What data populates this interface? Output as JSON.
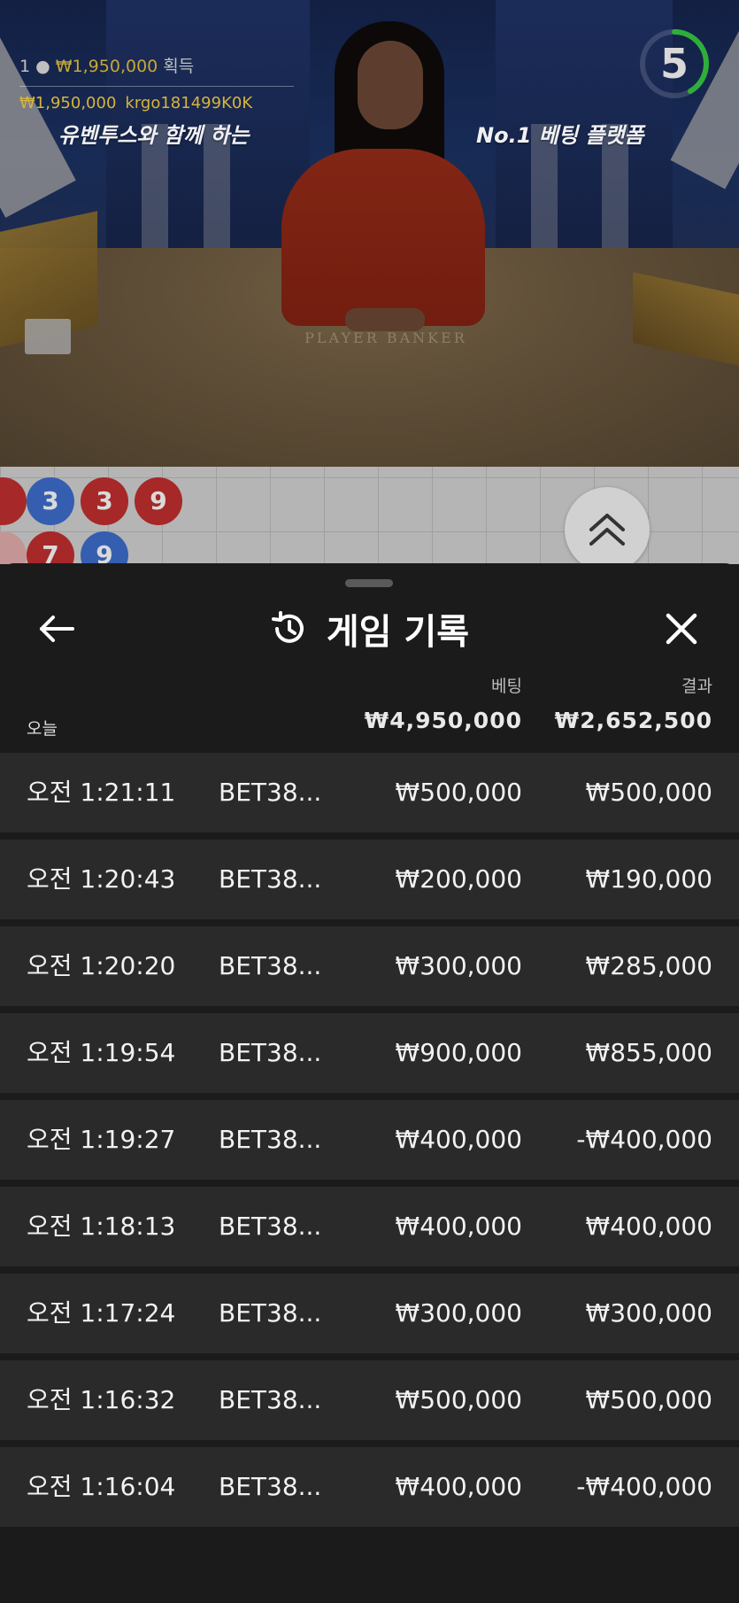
{
  "overlay": {
    "winner_count": "1",
    "winner_amount": "₩1,950,000",
    "winner_suffix": "획득",
    "balance": "₩1,950,000",
    "username": "krgo181499K0K",
    "banner_left": "유벤투스와 함께 하는",
    "banner_right": "No.1 베팅 플랫폼",
    "table_text": "PLAYER   BANKER",
    "countdown": "5"
  },
  "roadmap": {
    "beads": [
      {
        "value": "3",
        "color": "blue"
      },
      {
        "value": "3",
        "color": "red"
      },
      {
        "value": "9",
        "color": "red"
      },
      {
        "value": "7",
        "color": "red"
      },
      {
        "value": "9",
        "color": "blue"
      }
    ]
  },
  "history": {
    "title": "게임 기록",
    "col_bet": "베팅",
    "col_result": "결과",
    "period_label": "오늘",
    "total_bet": "₩4,950,000",
    "total_result": "₩2,652,500",
    "rows": [
      {
        "time": "오전 1:21:11",
        "id": "BET38...",
        "bet": "₩500,000",
        "result": "₩500,000"
      },
      {
        "time": "오전 1:20:43",
        "id": "BET38...",
        "bet": "₩200,000",
        "result": "₩190,000"
      },
      {
        "time": "오전 1:20:20",
        "id": "BET38...",
        "bet": "₩300,000",
        "result": "₩285,000"
      },
      {
        "time": "오전 1:19:54",
        "id": "BET38...",
        "bet": "₩900,000",
        "result": "₩855,000"
      },
      {
        "time": "오전 1:19:27",
        "id": "BET38...",
        "bet": "₩400,000",
        "result": "-₩400,000"
      },
      {
        "time": "오전 1:18:13",
        "id": "BET38...",
        "bet": "₩400,000",
        "result": "₩400,000"
      },
      {
        "time": "오전 1:17:24",
        "id": "BET38...",
        "bet": "₩300,000",
        "result": "₩300,000"
      },
      {
        "time": "오전 1:16:32",
        "id": "BET38...",
        "bet": "₩500,000",
        "result": "₩500,000"
      },
      {
        "time": "오전 1:16:04",
        "id": "BET38...",
        "bet": "₩400,000",
        "result": "-₩400,000"
      }
    ]
  },
  "icons": {
    "back": "arrow-left-icon",
    "history": "history-icon",
    "close": "close-icon",
    "expand": "chevron-double-up-icon"
  },
  "colors": {
    "gold": "#d7b43a",
    "bead_blue": "#3f6fcf",
    "bead_red": "#c42f2f",
    "sheet_bg": "#1b1b1b",
    "row_bg": "#2a2a2a",
    "timer_ring": "#2fae3a"
  }
}
